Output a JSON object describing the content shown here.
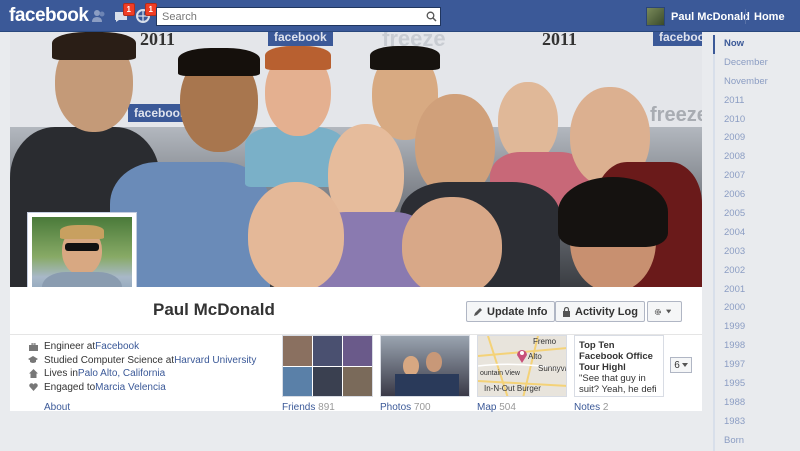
{
  "header": {
    "logo": "facebook",
    "friend_requests_badge": "",
    "messages_badge": "1",
    "notifications_badge": "1",
    "search_placeholder": "Search",
    "profile_name": "Paul McDonald",
    "home_label": "Home"
  },
  "cover": {
    "banner_year_left": "2011",
    "banner_year_right": "2011",
    "banner_brand": "facebook",
    "banner_freeze": "freeze"
  },
  "profile": {
    "name": "Paul McDonald",
    "update_info_label": "Update Info",
    "activity_log_label": "Activity Log"
  },
  "about": {
    "rows": [
      {
        "icon": "briefcase-icon",
        "prefix": "Engineer at ",
        "link": "Facebook",
        "suffix": ""
      },
      {
        "icon": "graduation-cap-icon",
        "prefix": "Studied Computer Science at ",
        "link": "Harvard University",
        "suffix": ""
      },
      {
        "icon": "house-icon",
        "prefix": "Lives in ",
        "link": "Palo Alto, California",
        "suffix": ""
      },
      {
        "icon": "heart-icon",
        "prefix": "Engaged to ",
        "link": "Marcia Velencia",
        "suffix": ""
      }
    ]
  },
  "sections": {
    "about_label": "About",
    "friends_label": "Friends",
    "friends_count": "891",
    "photos_label": "Photos",
    "photos_count": "700",
    "map_label": "Map",
    "map_count": "504",
    "notes_label": "Notes",
    "notes_count": "2",
    "more_count": "6"
  },
  "map_tile": {
    "label_1": "Fremo",
    "label_2": "Alto",
    "label_3": "Sunnyva",
    "label_4": "ountain View",
    "label_5": "In-N-Out Burger"
  },
  "notes_tile": {
    "title": "Top Ten Facebook Office Tour Highl",
    "body": "\"See that guy in suit? Yeah, he defi"
  },
  "timeline": {
    "items": [
      "Now",
      "December",
      "November",
      "2011",
      "2010",
      "2009",
      "2008",
      "2007",
      "2006",
      "2005",
      "2004",
      "2003",
      "2002",
      "2001",
      "2000",
      "1999",
      "1998",
      "1997",
      "1995",
      "1988",
      "1983",
      "Born"
    ],
    "active_index": 0
  },
  "colors": {
    "brand_blue": "#3b5998",
    "badge_red": "#f03d25",
    "link_blue": "#3b5998"
  }
}
